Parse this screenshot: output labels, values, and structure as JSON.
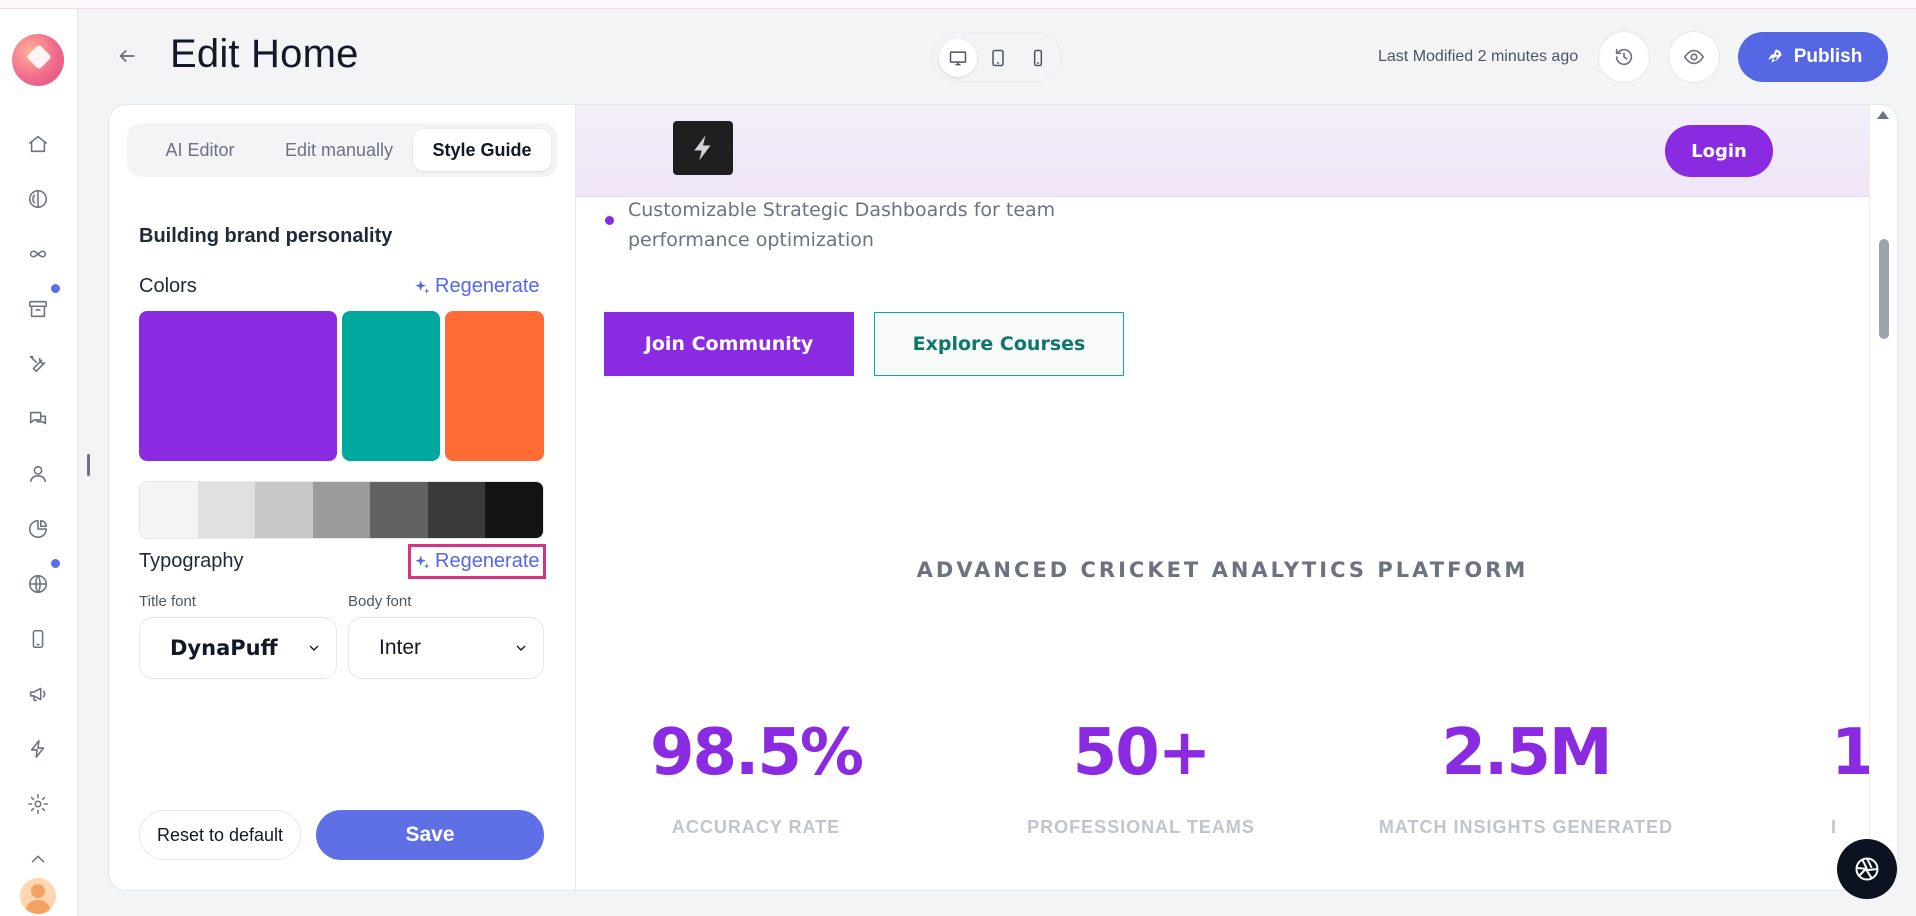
{
  "header": {
    "title": "Edit Home",
    "last_modified": "Last Modified 2 minutes ago",
    "publish_label": "Publish",
    "device_modes": [
      "desktop",
      "tablet",
      "mobile"
    ],
    "active_device": "desktop"
  },
  "rail": {
    "icons": [
      "home-icon",
      "brain-icon",
      "infinity-icon",
      "archive-icon",
      "tools-icon",
      "chat-icon",
      "user-icon",
      "pie-chart-icon",
      "globe-icon",
      "mobile-icon",
      "megaphone-icon",
      "lightning-icon",
      "settings-icon",
      "chevron-up-icon"
    ]
  },
  "panel": {
    "tabs": [
      {
        "label": "AI Editor",
        "active": false
      },
      {
        "label": "Edit manually",
        "active": false
      },
      {
        "label": "Style Guide",
        "active": true
      }
    ],
    "section_title": "Building brand personality",
    "colors_label": "Colors",
    "regenerate_label": "Regenerate",
    "typography_label": "Typography",
    "colors": {
      "primary": "#8a2be2",
      "secondary": "#00a99d",
      "accent": "#ff6b35",
      "greys": [
        "#f4f4f4",
        "#e0e0e0",
        "#c8c8c8",
        "#9b9b9b",
        "#616161",
        "#3a3a3a",
        "#141414"
      ]
    },
    "title_font_label": "Title font",
    "title_font_value": "DynaPuff",
    "body_font_label": "Body font",
    "body_font_value": "Inter",
    "reset_label": "Reset to default",
    "save_label": "Save"
  },
  "preview": {
    "login_label": "Login",
    "bullet_text": "Customizable Strategic Dashboards for team performance optimization",
    "join_label": "Join Community",
    "explore_label": "Explore Courses",
    "section_heading": "ADVANCED CRICKET ANALYTICS PLATFORM",
    "stats": [
      {
        "value": "98.5%",
        "label": "ACCURACY RATE"
      },
      {
        "value": "50+",
        "label": "PROFESSIONAL TEAMS"
      },
      {
        "value": "2.5M",
        "label": "MATCH INSIGHTS GENERATED"
      },
      {
        "value": "1",
        "label": "I"
      }
    ]
  }
}
